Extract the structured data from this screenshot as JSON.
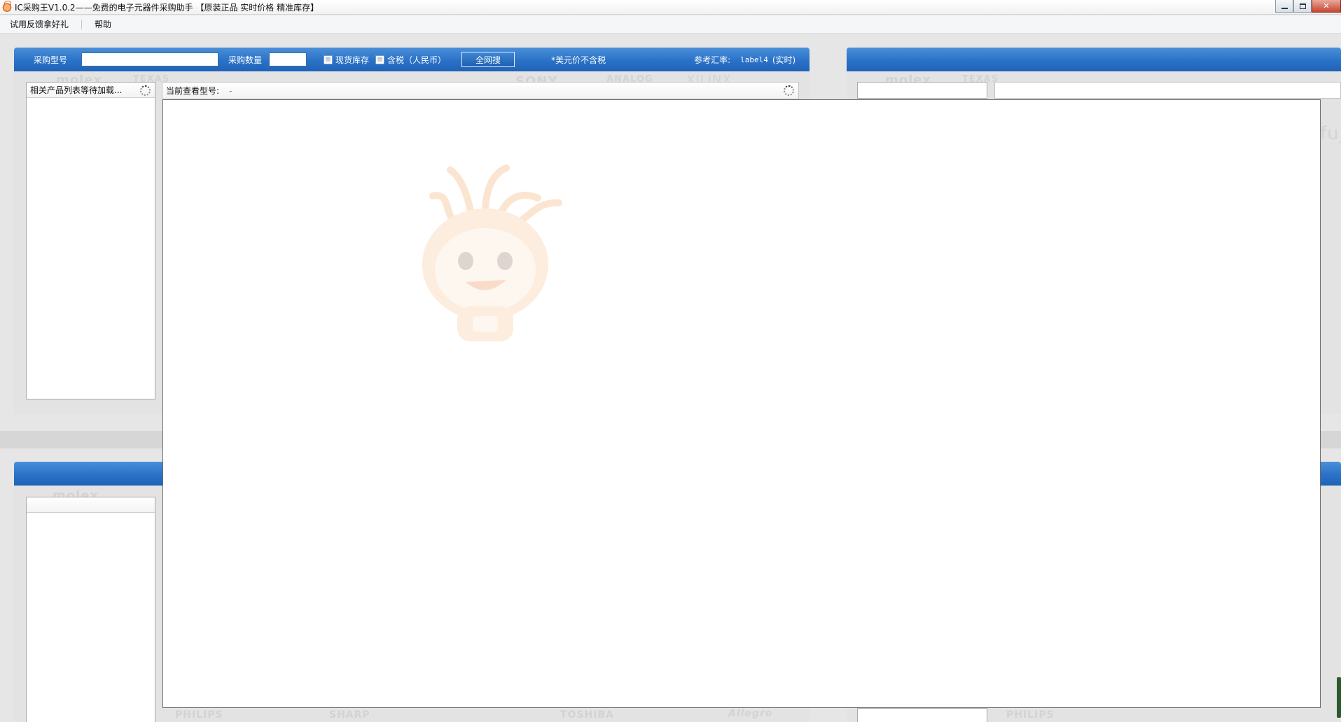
{
  "window": {
    "title": "IC采购王V1.0.2——免费的电子元器件采购助手 【原装正品 实时价格 精准库存】",
    "buttons": {
      "minimize": "minimize-icon",
      "maximize": "restore-icon",
      "close": "✕"
    }
  },
  "menu": {
    "items": [
      "试用反馈拿好礼",
      "帮助"
    ]
  },
  "search": {
    "model_label": "采购型号",
    "model_value": "",
    "qty_label": "采购数量",
    "qty_value": "",
    "stock_label": "现货库存",
    "stock_checked": false,
    "tax_label": "含税（人民币）",
    "tax_checked": false,
    "search_button": "全网搜",
    "usd_note": "*美元价不含税",
    "rate_label": "参考汇率:",
    "rate_value": "label4",
    "rate_suffix": "(实时)"
  },
  "related": {
    "header": "相关产品列表等待加载..."
  },
  "current": {
    "label": "当前查看型号:",
    "value": "-"
  },
  "watermarks": [
    "molex",
    "TEXAS",
    "SONY",
    "ANALOG",
    "XILINX",
    "PHILIPS",
    "SHARP",
    "TOSHIBA",
    "Allegro",
    "fujitsu"
  ],
  "colors": {
    "accent": "#2a72c8",
    "panel_bg": "#e3e3e3"
  }
}
